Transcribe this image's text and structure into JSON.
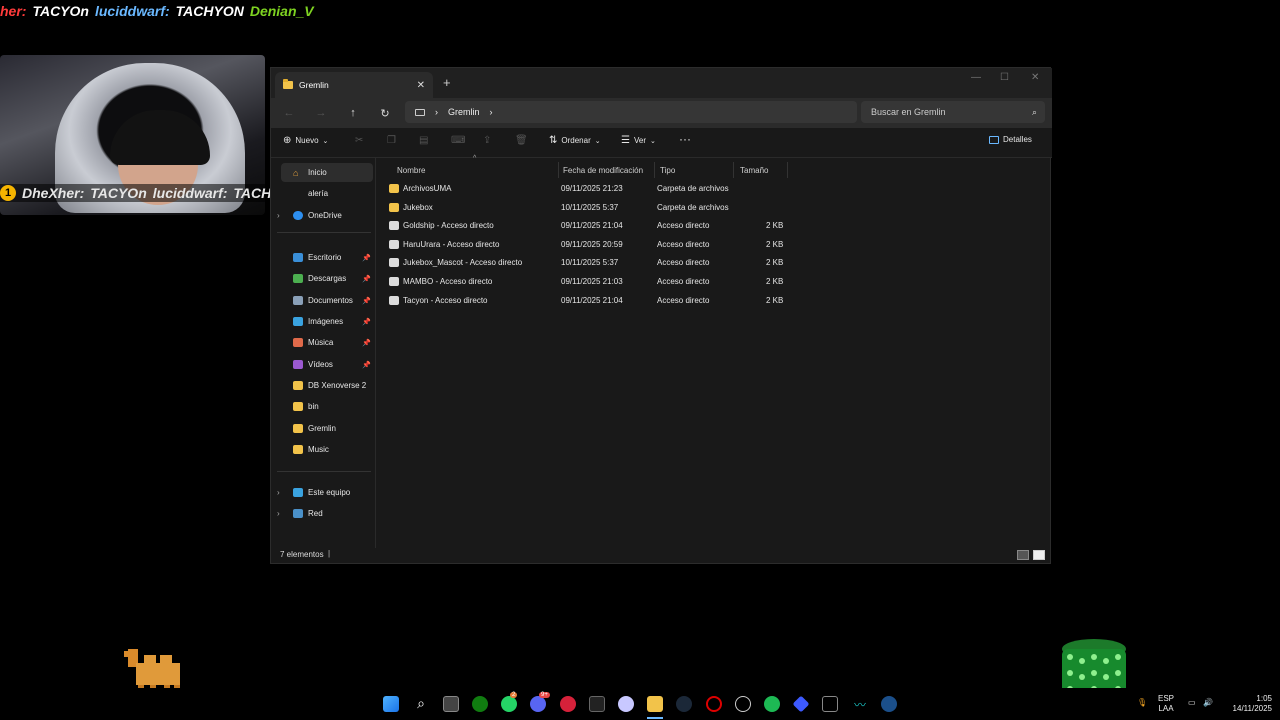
{
  "overlay": {
    "chat_top": {
      "prefix": "her:",
      "name1": "TACYOn",
      "user2": "luciddwarf:",
      "name2": "TACHYON",
      "name3": "Denian_V"
    },
    "chat_mid": {
      "badge": "1",
      "user1": "DheXher:",
      "name1": "TACYOn",
      "user2": "luciddwarf:",
      "name2": "TACHYOI"
    }
  },
  "window": {
    "tab_title": "Gremlin",
    "breadcrumb": "Gremlin",
    "search_placeholder": "Buscar en Gremlin",
    "toolbar": {
      "new": "Nuevo",
      "sort": "Ordenar",
      "view": "Ver",
      "more": "···",
      "details": "Detalles"
    },
    "sidebar": {
      "home": "Inicio",
      "gallery": "alería",
      "onedrive": "OneDrive",
      "quick": [
        {
          "label": "Escritorio",
          "color": "#3a8fd8",
          "pinned": true
        },
        {
          "label": "Descargas",
          "color": "#4caf50",
          "pinned": true
        },
        {
          "label": "Documentos",
          "color": "#8aa0b8",
          "pinned": true
        },
        {
          "label": "Imágenes",
          "color": "#3aa3e0",
          "pinned": true
        },
        {
          "label": "Música",
          "color": "#e06a4a",
          "pinned": true
        },
        {
          "label": "Vídeos",
          "color": "#9b59d0",
          "pinned": true
        },
        {
          "label": "DB Xenoverse 2",
          "color": "#f2c34a",
          "pinned": false
        },
        {
          "label": "bin",
          "color": "#f2c34a",
          "pinned": false
        },
        {
          "label": "Gremlin",
          "color": "#f2c34a",
          "pinned": false
        },
        {
          "label": "Music",
          "color": "#f2c34a",
          "pinned": false
        }
      ],
      "this_pc": "Este equipo",
      "network": "Red"
    },
    "columns": {
      "name": "Nombre",
      "modified": "Fecha de modificación",
      "type": "Tipo",
      "size": "Tamaño"
    },
    "files": [
      {
        "name": "ArchivosUMA",
        "modified": "09/11/2025 21:23",
        "type": "Carpeta de archivos",
        "size": "",
        "kind": "folder"
      },
      {
        "name": "Jukebox",
        "modified": "10/11/2025 5:37",
        "type": "Carpeta de archivos",
        "size": "",
        "kind": "folder"
      },
      {
        "name": "Goldship - Acceso directo",
        "modified": "09/11/2025 21:04",
        "type": "Acceso directo",
        "size": "2 KB",
        "kind": "shortcut"
      },
      {
        "name": "HaruUrara - Acceso directo",
        "modified": "09/11/2025 20:59",
        "type": "Acceso directo",
        "size": "2 KB",
        "kind": "shortcut"
      },
      {
        "name": "Jukebox_Mascot - Acceso directo",
        "modified": "10/11/2025 5:37",
        "type": "Acceso directo",
        "size": "2 KB",
        "kind": "shortcut"
      },
      {
        "name": "MAMBO - Acceso directo",
        "modified": "09/11/2025 21:03",
        "type": "Acceso directo",
        "size": "2 KB",
        "kind": "shortcut"
      },
      {
        "name": "Tacyon - Acceso directo",
        "modified": "09/11/2025 21:04",
        "type": "Acceso directo",
        "size": "2 KB",
        "kind": "shortcut"
      }
    ],
    "status": "7 elementos"
  },
  "taskbar": {
    "lang": "ESP",
    "layout": "LAA",
    "time": "1:05",
    "date": "14/11/2025",
    "whatsapp_badge": "2",
    "discord_badge": "9+"
  }
}
